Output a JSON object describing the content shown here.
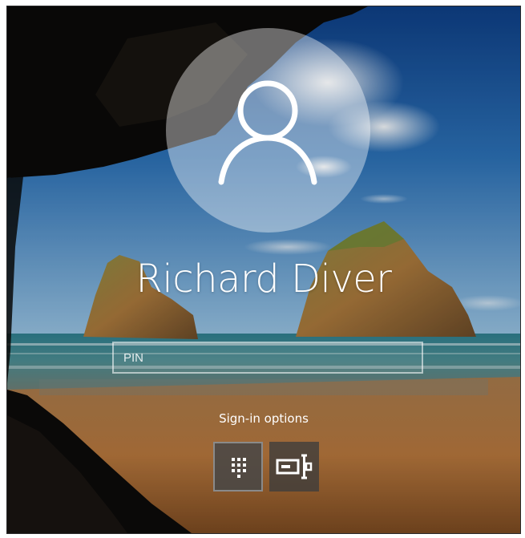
{
  "user": {
    "name": "Richard Diver"
  },
  "pin_field": {
    "placeholder": "PIN",
    "value": ""
  },
  "signin_options": {
    "label": "Sign-in options",
    "options": [
      {
        "icon": "keypad-icon",
        "selected": true
      },
      {
        "icon": "password-key-icon",
        "selected": false
      }
    ]
  },
  "colors": {
    "sky": "#2f6fb3",
    "sea": "#1f6e86",
    "sand": "#b5763e",
    "cave": "#0c0c0c",
    "text": "#ffffff"
  }
}
